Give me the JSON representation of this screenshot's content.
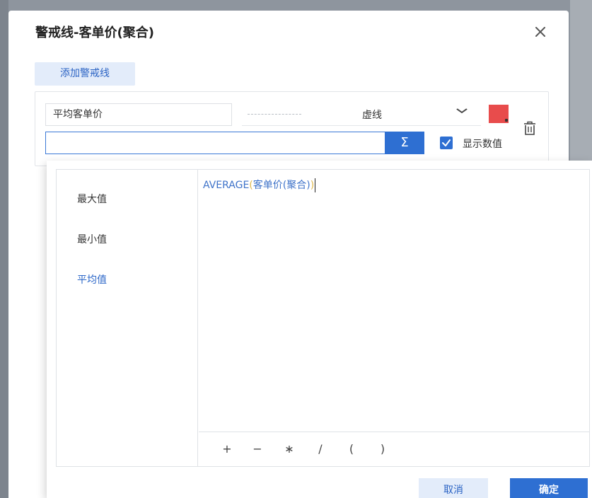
{
  "dialog": {
    "title": "警戒线-客单价(聚合)",
    "close_icon": "close-icon",
    "add_button_label": "添加警戒线"
  },
  "warning_line": {
    "name_value": "平均客单价",
    "line_style_label": "虚线",
    "color": "#e84c4c",
    "delete_icon": "trash-icon",
    "formula_value": "",
    "formula_button_icon": "Σ",
    "show_value_checked": true,
    "show_value_label": "显示数值"
  },
  "function_picker": {
    "functions": [
      {
        "label": "最大值",
        "active": false
      },
      {
        "label": "最小值",
        "active": false
      },
      {
        "label": "平均值",
        "active": true
      }
    ],
    "expression": {
      "fn": "AVERAGE",
      "open_paren": "(",
      "field": "客单价(聚合)",
      "close_paren": ")"
    },
    "operators": [
      "+",
      "−",
      "∗",
      "/",
      "(",
      ")"
    ]
  },
  "footer": {
    "cancel_label": "取消",
    "ok_label": "确定"
  },
  "colors": {
    "accent": "#2e6fd2",
    "accent_light": "#e3ecfa",
    "swatch": "#e84c4c"
  }
}
